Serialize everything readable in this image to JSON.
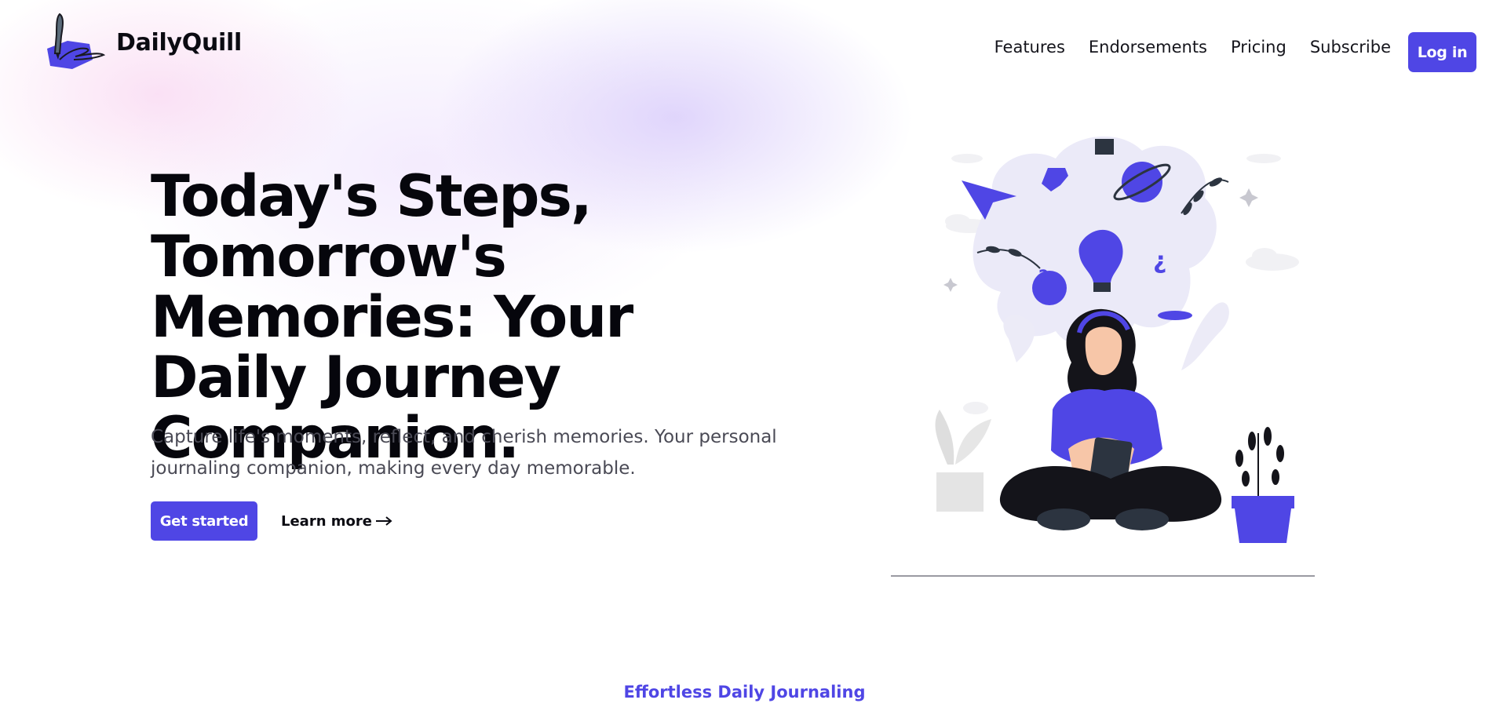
{
  "brand": {
    "name": "DailyQuill",
    "logo_icon": "quill-pen-logo-icon"
  },
  "nav": {
    "items": [
      {
        "label": "Features"
      },
      {
        "label": "Endorsements"
      },
      {
        "label": "Pricing"
      },
      {
        "label": "Subscribe"
      }
    ],
    "login_label": "Log in"
  },
  "hero": {
    "title": "Today's Steps, Tomorrow's Memories: Your Daily Journey Companion.",
    "subtitle": "Capture life's moments, reflect, and cherish memories. Your personal journaling companion, making every day memorable.",
    "primary_cta": "Get started",
    "secondary_cta": "Learn more",
    "secondary_cta_icon": "arrow-right-icon",
    "illustration": "woman-journaling-illustration"
  },
  "section": {
    "eyebrow": "Effortless Daily Journaling"
  },
  "colors": {
    "accent": "#4f46e5",
    "text": "#0b0b12",
    "muted": "#4a4a55"
  }
}
